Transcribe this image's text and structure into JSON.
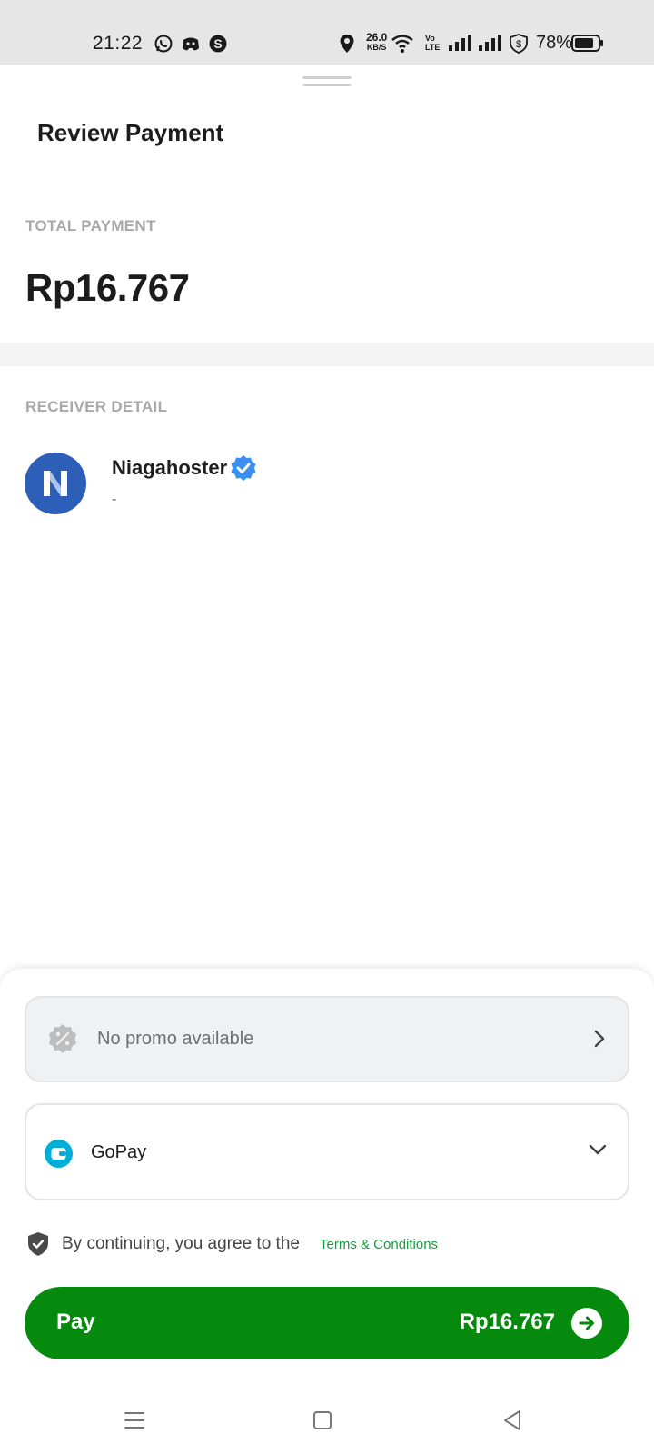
{
  "status_bar": {
    "time": "21:22",
    "net_speed": "26.0",
    "net_unit": "KB/S",
    "volte_top": "Vo",
    "volte_bottom": "LTE",
    "battery": "78%"
  },
  "sheet": {
    "title": "Review Payment",
    "total_label": "TOTAL PAYMENT",
    "total_amount": "Rp16.767",
    "receiver_label": "RECEIVER DETAIL",
    "receiver": {
      "name": "Niagahoster",
      "subtitle": "-",
      "logo_letter": "N",
      "verified": true
    }
  },
  "promo": {
    "text": "No promo available",
    "icon": "discount-icon"
  },
  "payment_method": {
    "selected": "GoPay",
    "icon": "gopay-wallet-icon"
  },
  "terms": {
    "text": "By continuing, you agree to the",
    "link": "Terms & Conditions"
  },
  "pay_button": {
    "label": "Pay",
    "amount": "Rp16.767"
  },
  "colors": {
    "primary_green": "#058a0d",
    "link_green": "#1a9c3e",
    "verified_blue": "#3b8ff0",
    "logo_blue": "#2d5fb8",
    "gopay_blue": "#00aed6"
  }
}
